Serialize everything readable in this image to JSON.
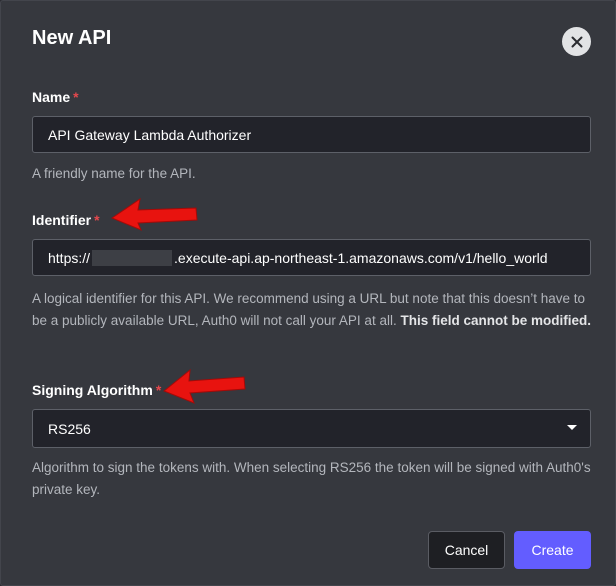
{
  "modal": {
    "title": "New API"
  },
  "fields": {
    "name": {
      "label": "Name",
      "required_mark": "*",
      "value": "API Gateway Lambda Authorizer",
      "help": "A friendly name for the API."
    },
    "identifier": {
      "label": "Identifier",
      "required_mark": "*",
      "value_prefix": "https://",
      "value_suffix": ".execute-api.ap-northeast-1.amazonaws.com/v1/hello_world",
      "help": "A logical identifier for this API. We recommend using a URL but note that this doesn’t have to be a publicly available URL, Auth0 will not call your API at all. ",
      "help_bold": "This field cannot be modified."
    },
    "signing_algorithm": {
      "label": "Signing Algorithm",
      "required_mark": "*",
      "selected": "RS256",
      "help": "Algorithm to sign the tokens with. When selecting RS256 the token will be signed with Auth0's private key."
    }
  },
  "actions": {
    "cancel_label": "Cancel",
    "create_label": "Create"
  },
  "colors": {
    "accent": "#635dff",
    "required": "#e5484d",
    "annotation_arrow": "#e8130f"
  },
  "icons": {
    "close": "close-icon",
    "dropdown": "chevron-down-icon",
    "annotation": "red-arrow-annotation"
  }
}
